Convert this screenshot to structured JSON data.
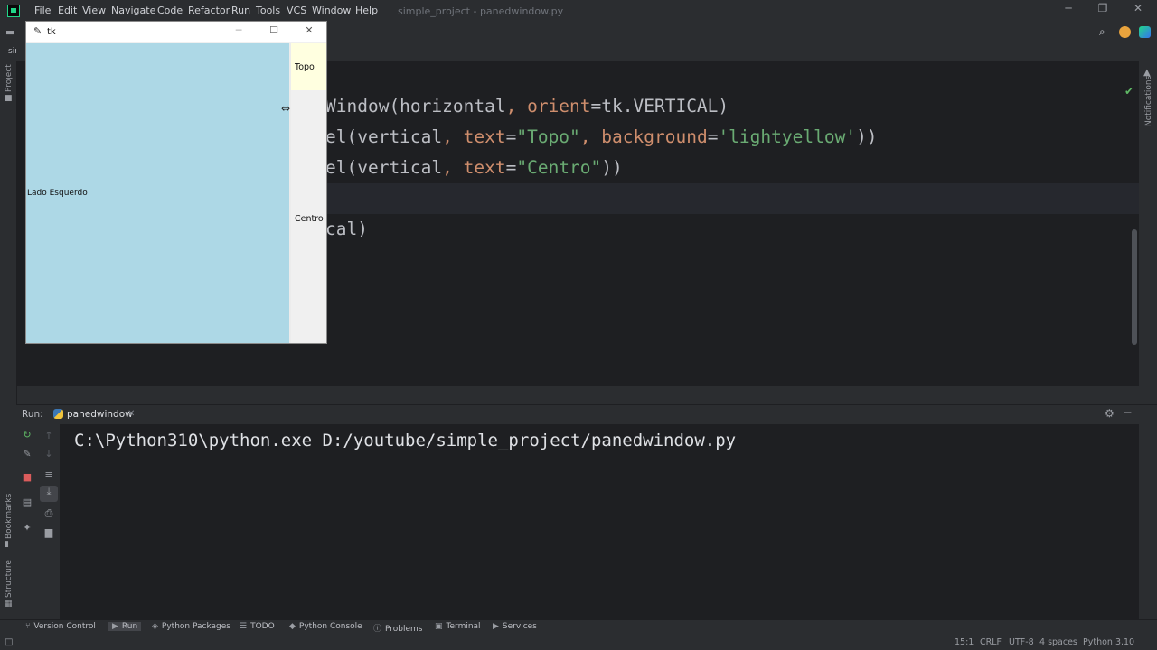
{
  "app": {
    "menu": [
      "File",
      "Edit",
      "View",
      "Navigate",
      "Code",
      "Refactor",
      "Run",
      "Tools",
      "VCS",
      "Window",
      "Help"
    ],
    "window_title": "simple_project - panedwindow.py",
    "project_tab": "simp"
  },
  "editor": {
    "lines": [
      {
        "p1": "Window(horizontal",
        "p2": ", ",
        "p3": "orient",
        "p4": "=tk.VERTICAL)"
      },
      {
        "p1": "el(vertical",
        "p2": ", ",
        "p3": "text",
        "p4": "=",
        "p5": "\"Topo\"",
        "p6": ", ",
        "p7": "background",
        "p8": "=",
        "p9": "'lightyellow'",
        "p10": "))"
      },
      {
        "p1": "el(vertical",
        "p2": ", ",
        "p3": "text",
        "p4": "=",
        "p5": "\"Centro\"",
        "p6": "))"
      },
      {
        "p1": "cal)"
      }
    ]
  },
  "tk": {
    "title": "tk",
    "left_label": "Lado Esquerdo",
    "top_label": "Topo",
    "center_label": "Centro",
    "colors": {
      "left": "#add8e6",
      "top": "#ffffe0"
    }
  },
  "run": {
    "label": "Run:",
    "tab": "panedwindow",
    "console_line": "C:\\Python310\\python.exe D:/youtube/simple_project/panedwindow.py"
  },
  "left_stripe": {
    "project": "Project",
    "bookmarks": "Bookmarks",
    "structure": "Structure"
  },
  "right_stripe": {
    "notifications": "Notifications"
  },
  "bottom_tools": [
    "Version Control",
    "Run",
    "Python Packages",
    "TODO",
    "Python Console",
    "Problems",
    "Terminal",
    "Services"
  ],
  "status": {
    "position": "15:1",
    "line_sep": "CRLF",
    "encoding": "UTF-8",
    "indent": "4 spaces",
    "interpreter": "Python 3.10"
  }
}
